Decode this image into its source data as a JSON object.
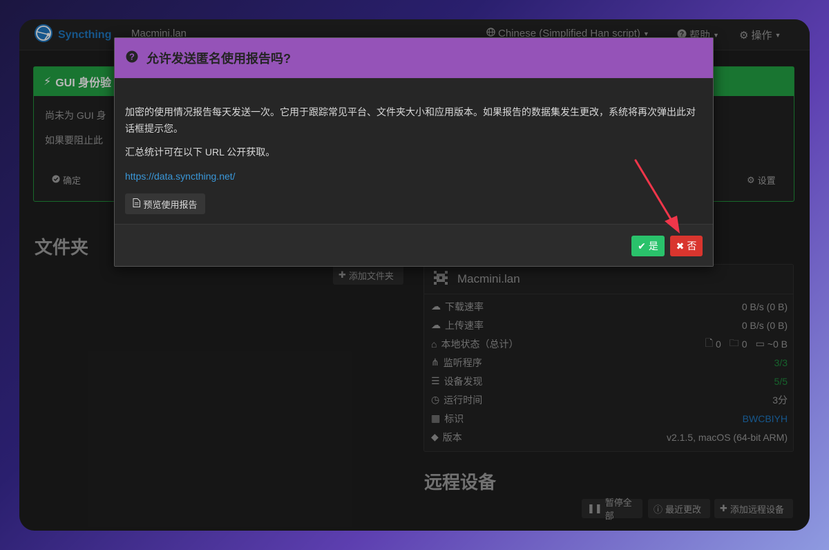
{
  "navbar": {
    "brand": "Syncthing",
    "device_name": "Macmini.lan",
    "language": "Chinese (Simplified Han script)",
    "help": "帮助",
    "actions": "操作"
  },
  "auth_panel": {
    "title": "GUI 身份验",
    "line1": "尚未为 GUI 身",
    "line2": "如果要阻止此",
    "ok_label": "确定",
    "settings_label": "设置"
  },
  "folders": {
    "title": "文件夹",
    "add_label": "添加文件夹"
  },
  "this_device": {
    "name": "Macmini.lan",
    "rows": [
      {
        "label": "下载速率",
        "value": "0 B/s (0 B)",
        "icon": "cloud-download-icon"
      },
      {
        "label": "上传速率",
        "value": "0 B/s (0 B)",
        "icon": "cloud-upload-icon"
      },
      {
        "label": "本地状态（总计）",
        "files": "0",
        "dirs": "0",
        "size": "~0 B",
        "icon": "home-icon"
      },
      {
        "label": "监听程序",
        "value": "3/3",
        "icon": "sitemap-icon"
      },
      {
        "label": "设备发现",
        "value": "5/5",
        "icon": "signpost-icon"
      },
      {
        "label": "运行时间",
        "value": "3分",
        "icon": "clock-icon"
      },
      {
        "label": "标识",
        "value": "BWCBIYH",
        "icon": "qrcode-icon"
      },
      {
        "label": "版本",
        "value": "v2.1.5, macOS (64-bit ARM)",
        "icon": "tag-icon"
      }
    ]
  },
  "remote_devices": {
    "title": "远程设备",
    "pause_all": "暂停全部",
    "recent_changes": "最近更改",
    "add_remote": "添加远程设备"
  },
  "modal": {
    "title": "允许发送匿名使用报告吗?",
    "paragraph1": "加密的使用情况报告每天发送一次。它用于跟踪常见平台、文件夹大小和应用版本。如果报告的数据集发生更改，系统将再次弹出此对话框提示您。",
    "paragraph2": "汇总统计可在以下 URL 公开获取。",
    "link": "https://data.syncthing.net/",
    "preview_label": "预览使用报告",
    "yes_label": "是",
    "no_label": "否"
  },
  "colors": {
    "modal_header": "#9553b8",
    "yes": "#2ac26b",
    "no": "#d9352e",
    "annotation_arrow": "#f0364a"
  }
}
